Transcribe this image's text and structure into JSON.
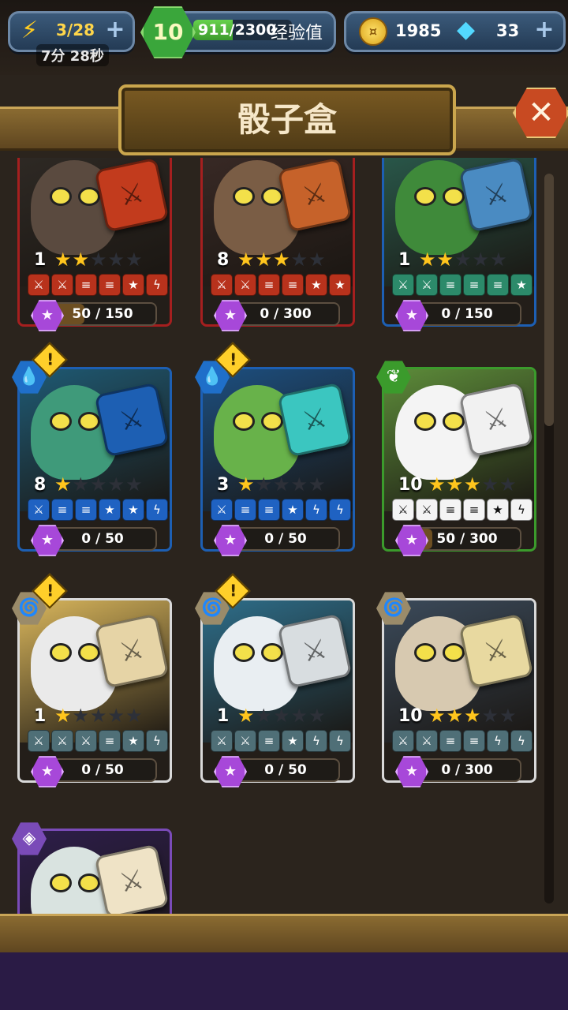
{
  "hud": {
    "energy": "3/28",
    "timer": "7分 28秒",
    "level": "10",
    "xp": "911/2300",
    "xp_fraction": 0.396,
    "xp_label": "经验值",
    "coins": "1985",
    "gems": "33"
  },
  "banner": {
    "title": "骰子盒"
  },
  "colors": {
    "fire": "#c0392b",
    "water": "#1f6fc9",
    "nature": "#3b9b2c",
    "wind": "#9a8b6a",
    "arcane": "#7a4bb8"
  },
  "cards": [
    {
      "level": "1",
      "stars": 2,
      "max_stars": 5,
      "progress": "50 / 150",
      "progress_fraction": 0.33,
      "element": "fire",
      "alert": false,
      "faces": [
        "sword",
        "sword",
        "shield",
        "shield",
        "star",
        "bolt"
      ],
      "dice_color": "#c23b1d",
      "border": "#a51f1f",
      "art": "#2f2a25",
      "creature": "#5a4a3f"
    },
    {
      "level": "8",
      "stars": 3,
      "max_stars": 5,
      "progress": "0 / 300",
      "progress_fraction": 0,
      "element": "fire",
      "alert": false,
      "faces": [
        "sword",
        "sword",
        "shield",
        "shield",
        "star",
        "star"
      ],
      "dice_color": "#c6622a",
      "border": "#a51f1f",
      "art": "#3a2a26",
      "creature": "#7a5d45"
    },
    {
      "level": "1",
      "stars": 2,
      "max_stars": 5,
      "progress": "0 / 150",
      "progress_fraction": 0,
      "element": "water",
      "alert": false,
      "faces": [
        "sword",
        "sword",
        "shield",
        "shield",
        "shield",
        "star"
      ],
      "dice_color": "#4a8bc2",
      "border": "#1d5fb3",
      "art": "#2a5b4d",
      "creature": "#3f8a3a"
    },
    {
      "level": "8",
      "stars": 1,
      "max_stars": 5,
      "progress": "0 / 50",
      "progress_fraction": 0,
      "element": "water",
      "alert": true,
      "faces": [
        "sword",
        "shield",
        "shield",
        "star",
        "star",
        "bolt"
      ],
      "dice_color": "#1d5fb3",
      "border": "#1d5fb3",
      "art": "#1f5a74",
      "creature": "#3f9a7a"
    },
    {
      "level": "3",
      "stars": 1,
      "max_stars": 5,
      "progress": "0 / 50",
      "progress_fraction": 0,
      "element": "water",
      "alert": true,
      "faces": [
        "sword",
        "shield",
        "shield",
        "star",
        "bolt",
        "bolt"
      ],
      "dice_color": "#3bc6c0",
      "border": "#1d5fb3",
      "art": "#1c4f80",
      "creature": "#68b24a"
    },
    {
      "level": "10",
      "stars": 3,
      "max_stars": 4,
      "progress": "50 / 300",
      "progress_fraction": 0.17,
      "element": "nature",
      "alert": false,
      "faces": [
        "sword",
        "sword",
        "shield",
        "shield",
        "star",
        "bolt"
      ],
      "dice_color": "#f1f1f1",
      "border": "#3b9b2c",
      "art": "#5d8c3a",
      "creature": "#f4f4f4"
    },
    {
      "level": "1",
      "stars": 1,
      "max_stars": 5,
      "progress": "0 / 50",
      "progress_fraction": 0,
      "element": "wind",
      "alert": true,
      "faces": [
        "sword",
        "sword",
        "sword",
        "shield",
        "star",
        "bolt"
      ],
      "dice_color": "#e6d4a6",
      "border": "#d9d9d9",
      "art": "#d9b65c",
      "creature": "#eaeaea"
    },
    {
      "level": "1",
      "stars": 1,
      "max_stars": 5,
      "progress": "0 / 50",
      "progress_fraction": 0,
      "element": "wind",
      "alert": true,
      "faces": [
        "sword",
        "sword",
        "shield",
        "star",
        "bolt",
        "bolt"
      ],
      "dice_color": "#d8dde0",
      "border": "#d9d9d9",
      "art": "#2e6e8a",
      "creature": "#e9eef2"
    },
    {
      "level": "10",
      "stars": 3,
      "max_stars": 5,
      "progress": "0 / 300",
      "progress_fraction": 0,
      "element": "wind",
      "alert": false,
      "faces": [
        "sword",
        "sword",
        "shield",
        "shield",
        "bolt",
        "bolt"
      ],
      "dice_color": "#e8d9a0",
      "border": "#d9d9d9",
      "art": "#3b4a5a",
      "creature": "#d7c9b0"
    },
    {
      "level": "",
      "stars": 0,
      "max_stars": 0,
      "progress": "",
      "progress_fraction": 0,
      "element": "arcane",
      "alert": false,
      "faces": [],
      "dice_color": "#efe3c6",
      "border": "#7a4bb8",
      "art": "#2d1e4a",
      "creature": "#d9e3e0"
    }
  ]
}
